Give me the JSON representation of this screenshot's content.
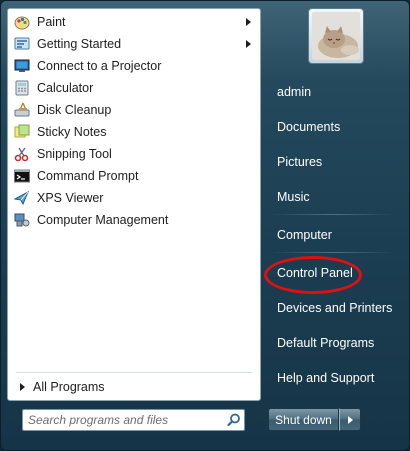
{
  "programs": [
    {
      "label": "Paint",
      "icon": "paint-icon",
      "submenu": true
    },
    {
      "label": "Getting Started",
      "icon": "getting-started-icon",
      "submenu": true
    },
    {
      "label": "Connect to a Projector",
      "icon": "projector-icon",
      "submenu": false
    },
    {
      "label": "Calculator",
      "icon": "calculator-icon",
      "submenu": false
    },
    {
      "label": "Disk Cleanup",
      "icon": "disk-cleanup-icon",
      "submenu": false
    },
    {
      "label": "Sticky Notes",
      "icon": "sticky-notes-icon",
      "submenu": false
    },
    {
      "label": "Snipping Tool",
      "icon": "snipping-tool-icon",
      "submenu": false
    },
    {
      "label": "Command Prompt",
      "icon": "command-prompt-icon",
      "submenu": false
    },
    {
      "label": "XPS Viewer",
      "icon": "xps-viewer-icon",
      "submenu": false
    },
    {
      "label": "Computer Management",
      "icon": "computer-management-icon",
      "submenu": false
    }
  ],
  "all_programs_label": "All Programs",
  "search": {
    "placeholder": "Search programs and files",
    "icon": "search-icon"
  },
  "user_picture_icon": "kitten-avatar",
  "right_links": {
    "user": "admin",
    "documents": "Documents",
    "pictures": "Pictures",
    "music": "Music",
    "computer": "Computer",
    "control_panel": "Control Panel",
    "devices": "Devices and Printers",
    "default_programs": "Default Programs",
    "help": "Help and Support"
  },
  "shutdown_label": "Shut down",
  "highlight_color": "#e01010"
}
